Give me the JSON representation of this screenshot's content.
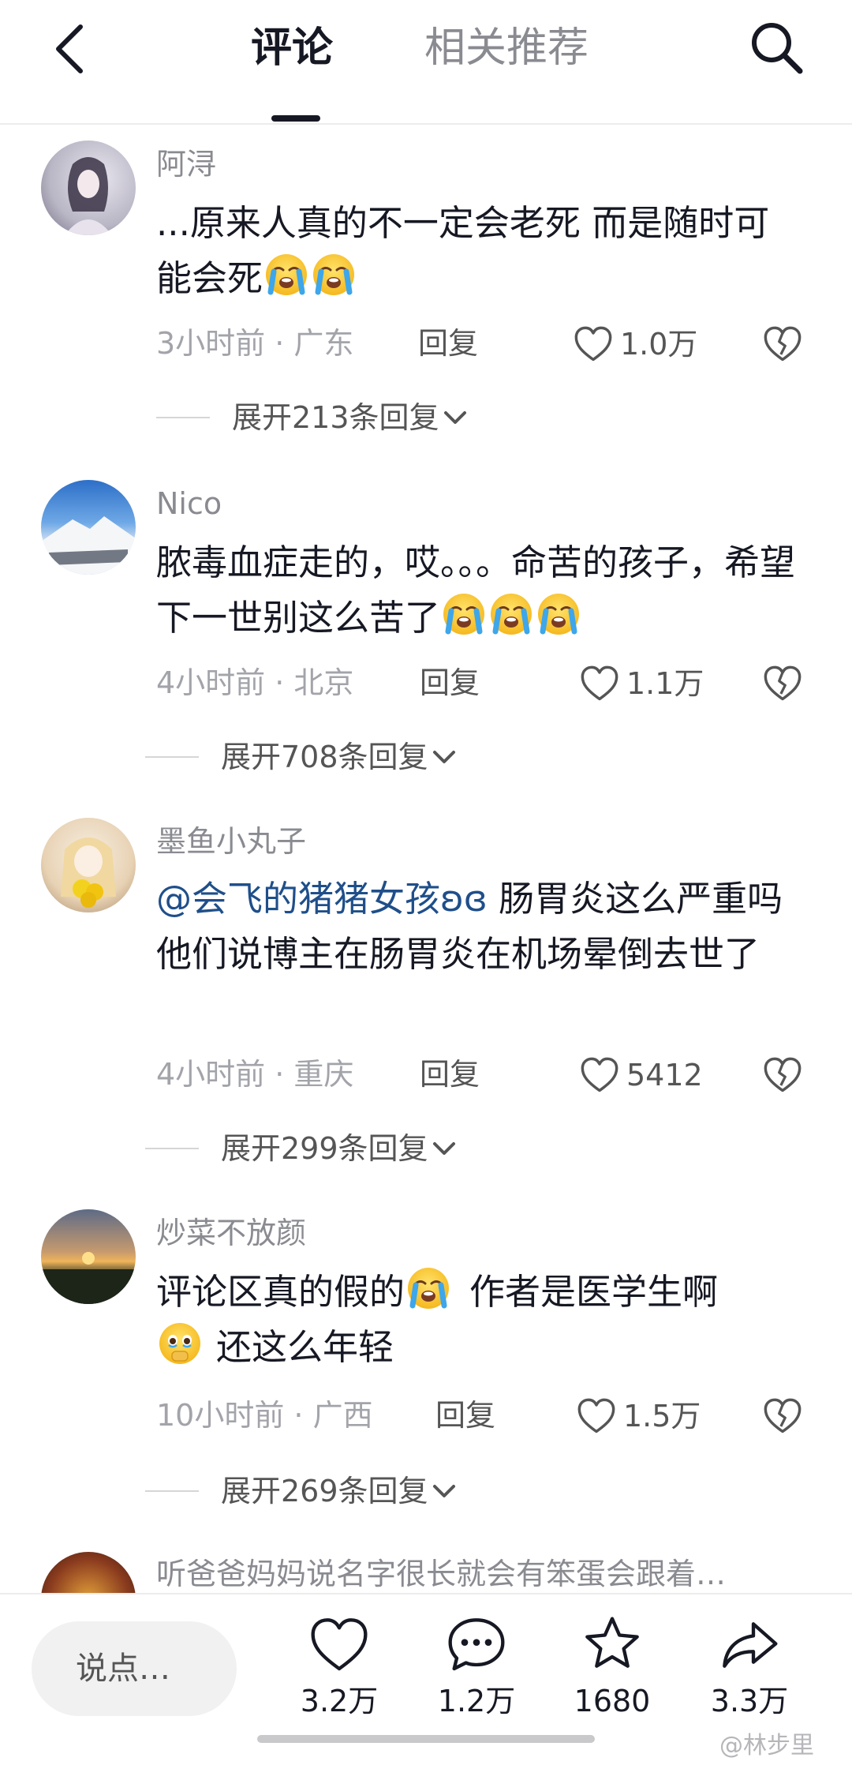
{
  "header": {
    "tab_comments": "评论",
    "tab_related": "相关推荐",
    "back_icon": "chevron-left-icon",
    "search_icon": "search-icon"
  },
  "comments": [
    {
      "username": "阿浔",
      "text": "...原来人真的不一定会老死 而是随时可能会死",
      "emojis": [
        "loudly-crying-emoji",
        "loudly-crying-emoji"
      ],
      "time_location": "3小时前 · 广东",
      "reply_label": "回复",
      "likes": "1.0万",
      "expand_label": "展开213条回复"
    },
    {
      "username": "Nico",
      "text": "脓毒血症走的，哎。。。命苦的孩子，希望下一世别这么苦了",
      "emojis": [
        "loudly-crying-emoji",
        "loudly-crying-emoji",
        "loudly-crying-emoji"
      ],
      "time_location": "4小时前 · 北京",
      "reply_label": "回复",
      "likes": "1.1万",
      "expand_label": "展开708条回复"
    },
    {
      "username": "墨鱼小丸子",
      "mention": "@会飞的猪猪女孩ʚɞ",
      "text": "肠胃炎这么严重吗 他们说博主在肠胃炎在机场晕倒去世了",
      "time_location": "4小时前 · 重庆",
      "reply_label": "回复",
      "likes": "5412",
      "expand_label": "展开299条回复"
    },
    {
      "username": "炒菜不放颜",
      "text_part1": "评论区真的假的",
      "text_part2": "作者是医学生啊",
      "text_part3": "还这么年轻",
      "emojis": [
        "loudly-crying-emoji",
        "holding-back-tears-emoji"
      ],
      "time_location": "10小时前 · 广西",
      "reply_label": "回复",
      "likes": "1.5万",
      "expand_label": "展开269条回复"
    },
    {
      "username": "听爸爸妈妈说名字很长就会有笨蛋会跟着…"
    }
  ],
  "bottom_bar": {
    "input_placeholder": "说点…",
    "like_count": "3.2万",
    "comment_count": "1.2万",
    "favorite_count": "1680",
    "share_count": "3.3万"
  },
  "watermark": "@林步里",
  "colors": {
    "text_primary": "#161823",
    "text_secondary": "#8a8b91",
    "mention": "#1f4f8a"
  }
}
